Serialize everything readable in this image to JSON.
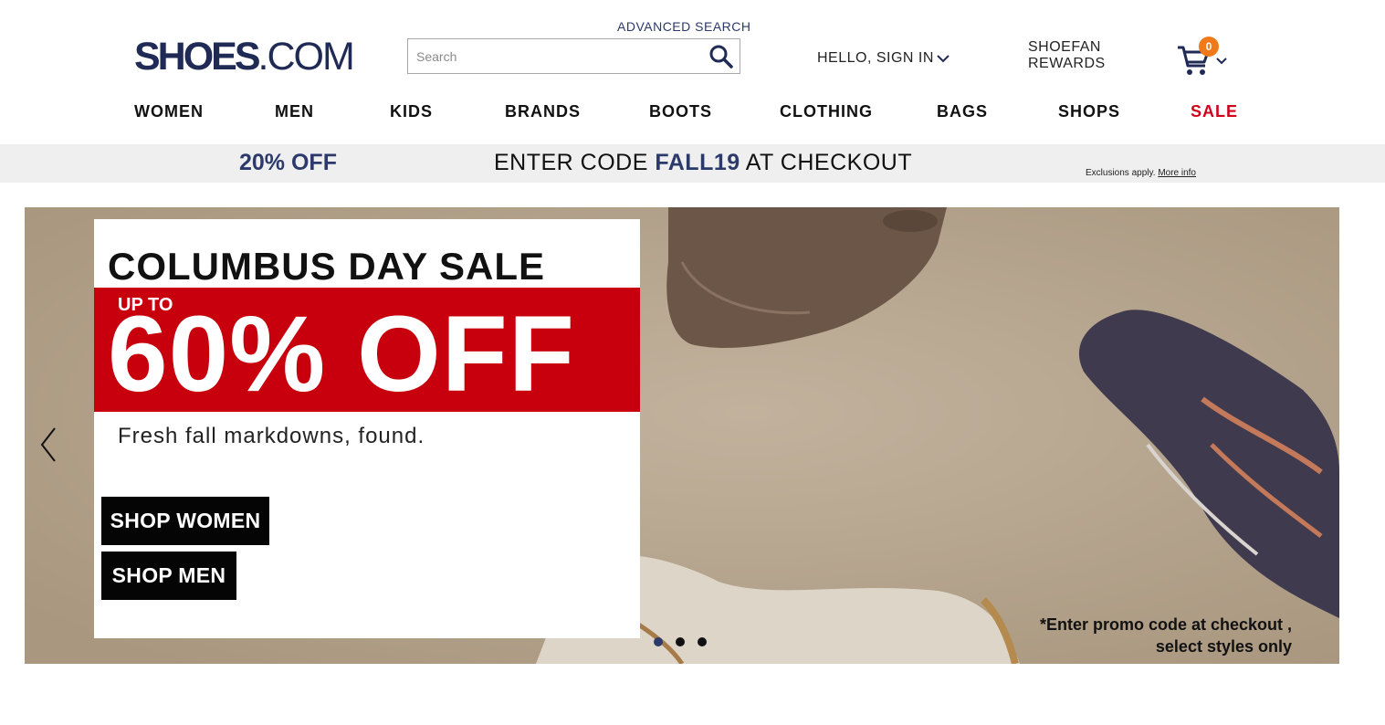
{
  "header": {
    "logo_bold": "SHOES",
    "logo_light": ".COM",
    "advanced_search": "ADVANCED SEARCH",
    "search_placeholder": "Search",
    "search_icon": "search-icon",
    "sign_in": "HELLO, SIGN IN",
    "rewards_line1": "SHOEFAN",
    "rewards_line2": "REWARDS",
    "cart_count": "0",
    "colors": {
      "brand_navy": "#1f2a55",
      "badge_orange": "#f07a1a"
    }
  },
  "nav": {
    "items": [
      "WOMEN",
      "MEN",
      "KIDS",
      "BRANDS",
      "BOOTS",
      "CLOTHING",
      "BAGS",
      "SHOPS",
      "SALE"
    ],
    "sale_color": "#d0021b"
  },
  "promo_bar": {
    "discount": "20% OFF",
    "text_before": "ENTER CODE ",
    "code": "FALL19",
    "text_after": " AT CHECKOUT",
    "exclusions": "Exclusions apply.",
    "more_info": "More info"
  },
  "hero": {
    "title": "COLUMBUS DAY SALE",
    "up_to": "UP TO",
    "discount": "60% OFF",
    "tagline": "Fresh fall markdowns, found.",
    "shop_women": "SHOP WOMEN",
    "shop_men": "SHOP MEN",
    "note_line1": "*Enter promo code at checkout ,",
    "note_line2": "select styles only",
    "slide_count": 3,
    "active_slide": 1,
    "colors": {
      "red_band": "#c8000d",
      "background": "#b9a892"
    }
  }
}
